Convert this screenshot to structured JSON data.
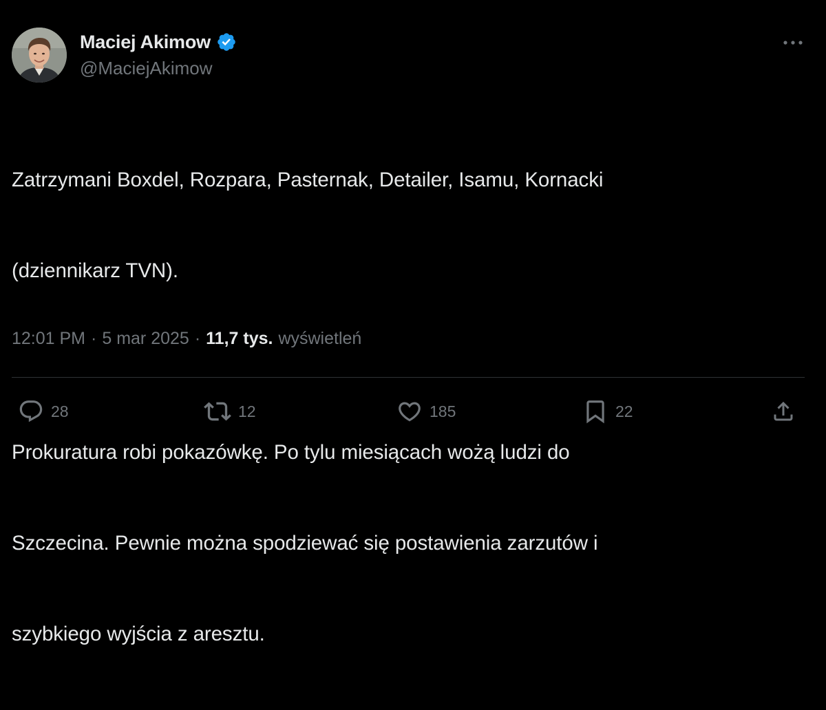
{
  "author": {
    "display_name": "Maciej Akimow",
    "handle": "@MaciejAkimow",
    "verified": true
  },
  "text": {
    "line1": "Zatrzymani Boxdel, Rozpara, Pasternak, Detailer, Isamu, Kornacki",
    "line2": "(dziennikarz TVN).",
    "line3": "Prokuratura robi pokazówkę. Po tylu miesiącach wożą ludzi do",
    "line4": "Szczecina. Pewnie można spodziewać się postawienia zarzutów i",
    "line5": "szybkiego wyjścia z aresztu."
  },
  "meta": {
    "time": "12:01 PM",
    "date": "5 mar 2025",
    "separator": "·",
    "views_count": "11,7 tys.",
    "views_label": "wyświetleń"
  },
  "actions": {
    "replies": "28",
    "reposts": "12",
    "likes": "185",
    "bookmarks": "22"
  },
  "icons": {
    "avatar": "avatar",
    "verified": "verified-badge-icon",
    "more": "more-icon",
    "reply": "reply-icon",
    "repost": "repost-icon",
    "like": "heart-icon",
    "bookmark": "bookmark-icon",
    "share": "share-icon"
  },
  "colors": {
    "background": "#000000",
    "primary_text": "#e7e9ea",
    "secondary_text": "#71767b",
    "verified_blue": "#1d9bf0",
    "divider": "#2f3336"
  }
}
